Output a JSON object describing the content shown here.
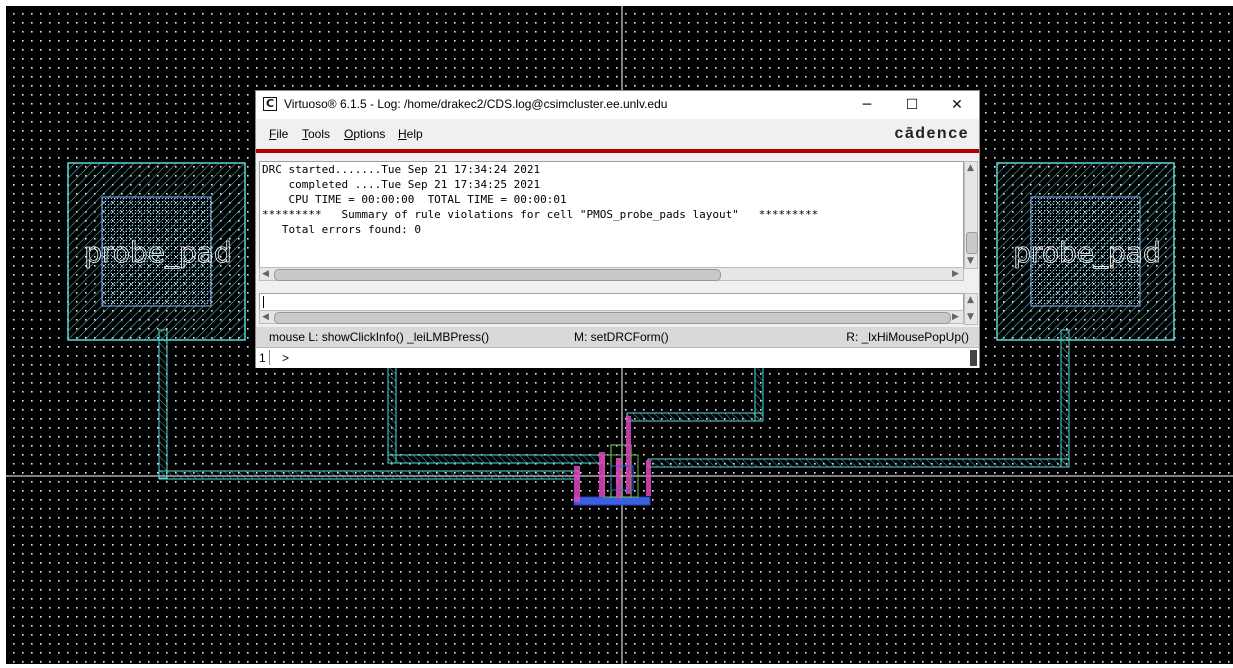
{
  "layout_canvas": {
    "pad_left_label": "probe_pad",
    "pad_right_label": "probe_pad",
    "colors": {
      "background": "#000000",
      "grid_dots": "#e8e8e8",
      "metal": "#57d7d7",
      "poly": "#e044c0",
      "nwell": "#5fbf4f",
      "diffusion": "#3a5fe0"
    }
  },
  "log_window": {
    "title": "Virtuoso® 6.1.5 - Log: /home/drakec2/CDS.log@csimcluster.ee.unlv.edu",
    "app_icon_glyph": "C",
    "controls": {
      "minimize": "─",
      "maximize": "☐",
      "close": "✕"
    },
    "menu": [
      "File",
      "Tools",
      "Options",
      "Help"
    ],
    "brand": "cādence",
    "log_lines": [
      "DRC started.......Tue Sep 21 17:34:24 2021",
      "    completed ....Tue Sep 21 17:34:25 2021",
      "    CPU TIME = 00:00:00  TOTAL TIME = 00:00:01",
      "*********   Summary of rule violations for cell \"PMOS_probe_pads layout\"   *********",
      "   Total errors found: 0"
    ],
    "mouse_bindings": {
      "left": "mouse L: showClickInfo() _leiLMBPress()",
      "middle": "M: setDRCForm()",
      "right": "R: _lxHiMousePopUp()"
    },
    "prompt": {
      "line_number": "1",
      "symbol": ">"
    }
  }
}
